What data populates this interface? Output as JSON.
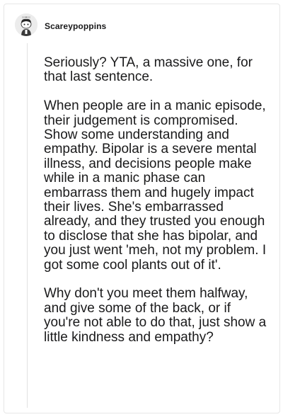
{
  "comment": {
    "username": "Scareypoppins",
    "avatar_icon": "snoo-avatar-icon",
    "paragraphs": [
      "Seriously? YTA, a massive one, for that last sentence.",
      "When people are in a manic episode, their judgement is compromised. Show some understanding and empathy. Bipolar is a severe mental illness, and decisions people make while in a manic phase can embarrass them and hugely impact their lives. She's embarrassed already, and they trusted you enough to disclose that she has bipolar, and you just went 'meh, not my problem. I got some cool plants out of it'.",
      "Why don't you meet them halfway, and give some of the back, or if you're not able to do that, just show a little kindness and empathy?"
    ]
  },
  "colors": {
    "text": "#1a1a1b",
    "border": "#e6e6e6",
    "thread_line": "#e2e2e2"
  }
}
